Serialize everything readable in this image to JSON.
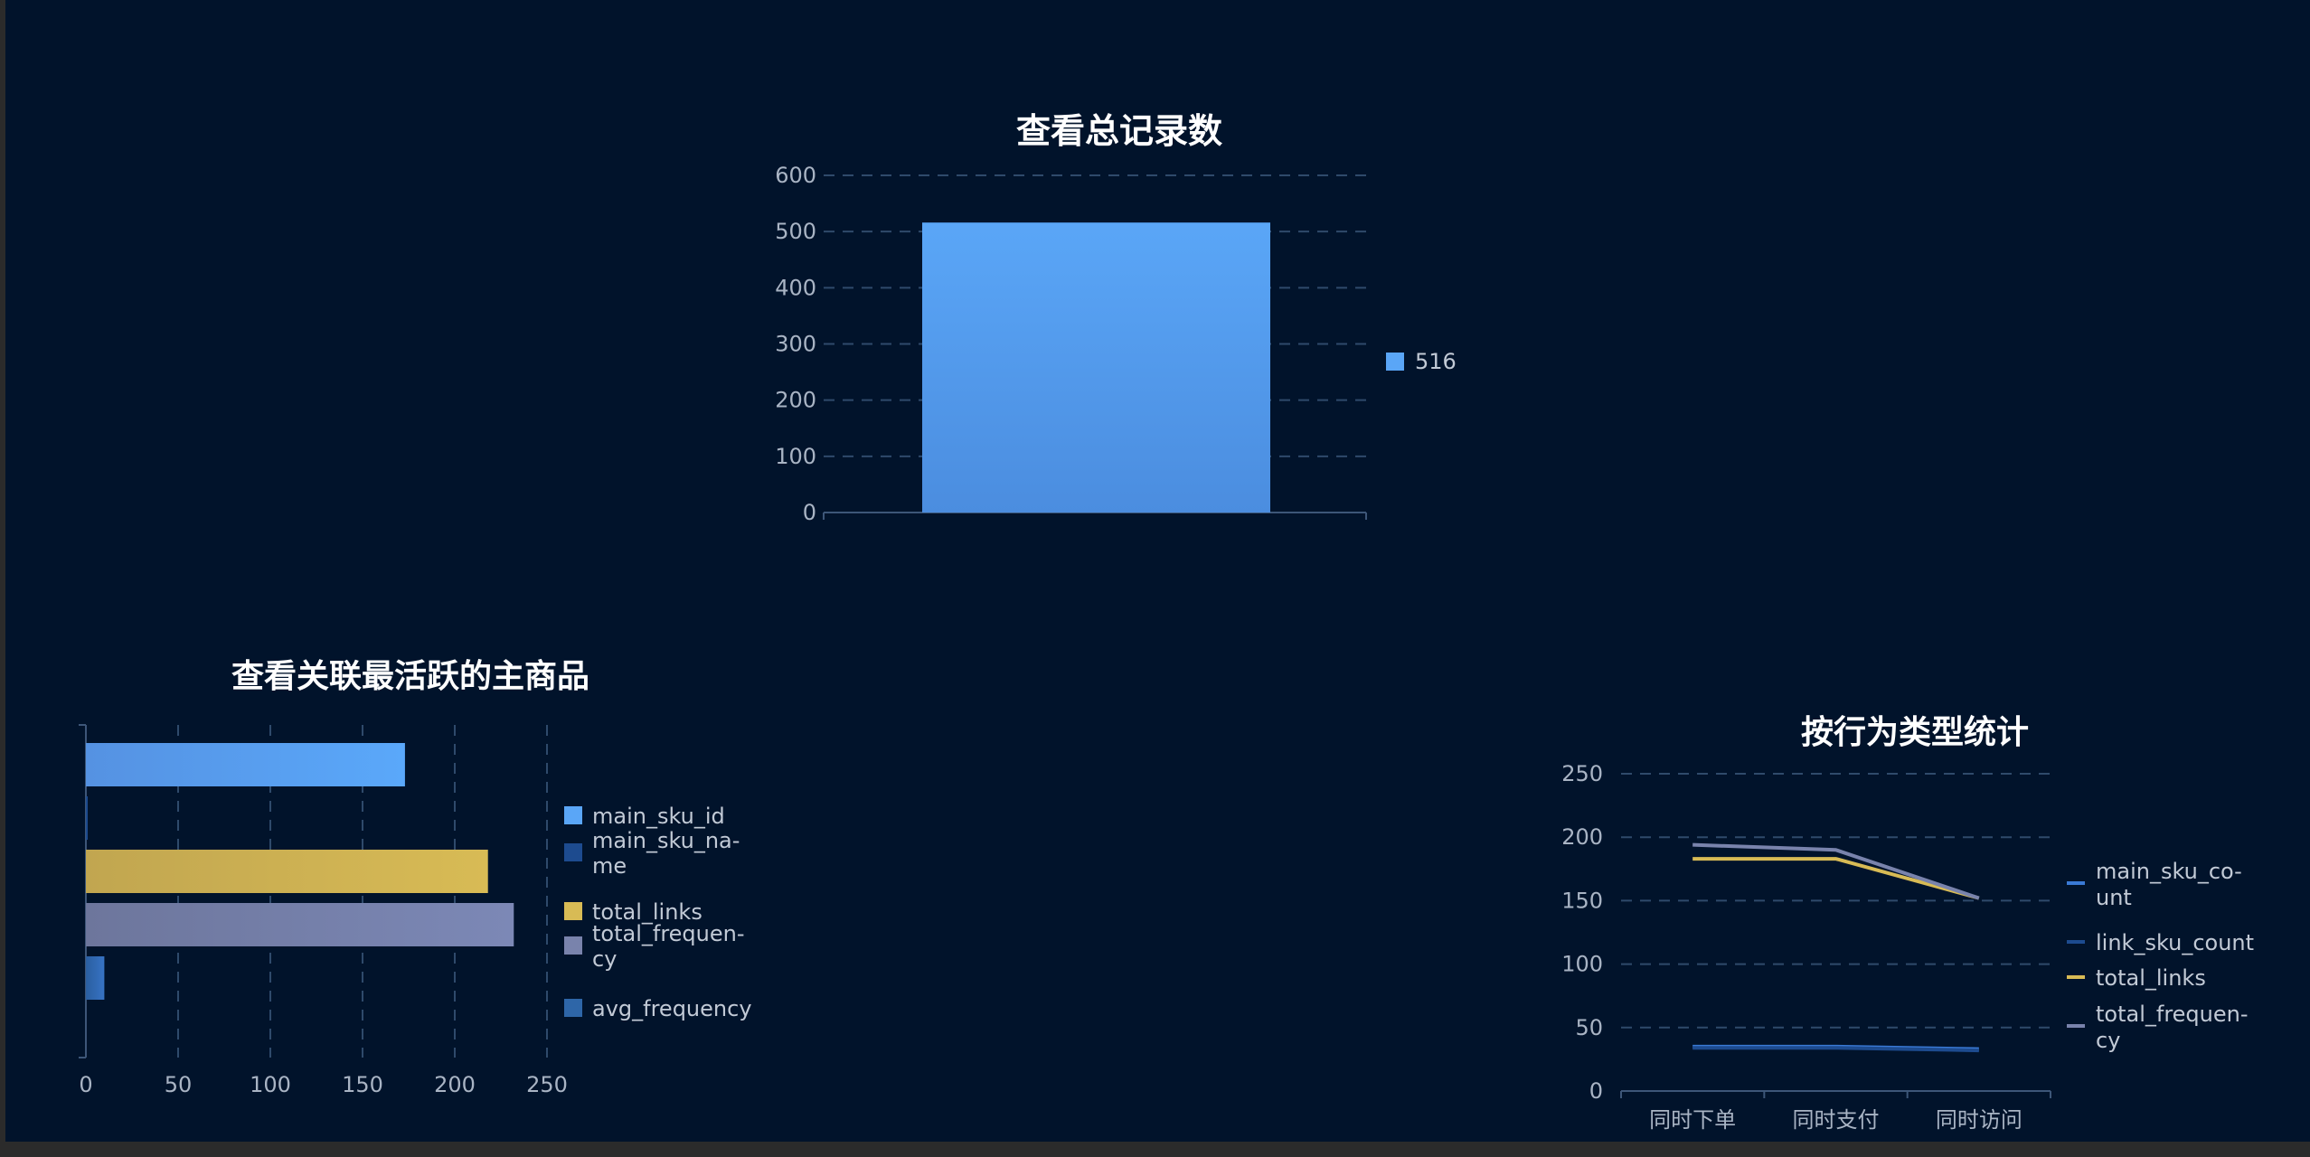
{
  "colors": {
    "background": "#01132b",
    "series": [
      "#5aa6f7",
      "#1d4b8f",
      "#d8bb55",
      "#7983ac",
      "#2e66a8"
    ]
  },
  "chart_data": [
    {
      "type": "bar",
      "title": "查看总记录数",
      "categories": [
        ""
      ],
      "series": [
        {
          "name": "516",
          "values": [
            516
          ]
        }
      ],
      "ylim": [
        0,
        600
      ],
      "yticks": [
        "0",
        "100",
        "200",
        "300",
        "400",
        "500",
        "600"
      ],
      "grid": true,
      "legend_position": "right"
    },
    {
      "type": "bar",
      "orientation": "horizontal",
      "title": "查看关联最活跃的主商品",
      "series": [
        {
          "name": "main_sku_id",
          "legend_lines": [
            "main_sku_id"
          ],
          "values": [
            173
          ]
        },
        {
          "name": "main_sku_name",
          "legend_lines": [
            "main_sku_na-",
            "me"
          ],
          "values": [
            1
          ]
        },
        {
          "name": "total_links",
          "legend_lines": [
            "total_links"
          ],
          "values": [
            218
          ]
        },
        {
          "name": "total_frequency",
          "legend_lines": [
            "total_frequen-",
            "cy"
          ],
          "values": [
            232
          ]
        },
        {
          "name": "avg_frequency",
          "legend_lines": [
            "avg_frequency"
          ],
          "values": [
            10
          ]
        }
      ],
      "xlim": [
        0,
        250
      ],
      "xticks": [
        "0",
        "50",
        "100",
        "150",
        "200",
        "250"
      ],
      "grid": true,
      "legend_position": "right"
    },
    {
      "type": "line",
      "title": "按行为类型统计",
      "categories": [
        "同时下单",
        "同时支付",
        "同时访问"
      ],
      "series": [
        {
          "name": "main_sku_count",
          "legend_lines": [
            "main_sku_co-",
            "unt"
          ],
          "values": [
            35,
            35,
            33
          ]
        },
        {
          "name": "link_sku_count",
          "legend_lines": [
            "link_sku_count"
          ],
          "values": [
            34,
            34,
            32
          ]
        },
        {
          "name": "total_links",
          "legend_lines": [
            "total_links"
          ],
          "values": [
            183,
            183,
            152
          ]
        },
        {
          "name": "total_frequency",
          "legend_lines": [
            "total_frequen-",
            "cy"
          ],
          "values": [
            194,
            190,
            152
          ]
        }
      ],
      "ylim": [
        0,
        250
      ],
      "yticks": [
        "0",
        "50",
        "100",
        "150",
        "200",
        "250"
      ],
      "grid": true,
      "legend_position": "right"
    }
  ]
}
